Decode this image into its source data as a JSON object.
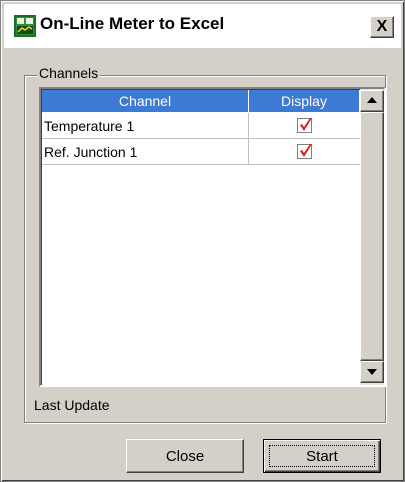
{
  "window": {
    "title": "On-Line Meter to Excel",
    "close_glyph": "X",
    "icon": "excel-meter-icon"
  },
  "channels_group": {
    "label": "Channels"
  },
  "table": {
    "columns": [
      "Channel",
      "Display"
    ],
    "rows": [
      {
        "channel": "Temperature 1",
        "display": true
      },
      {
        "channel": "Ref. Junction 1",
        "display": true
      }
    ],
    "header_color": "#3d7ad6",
    "check_color": "#e0201c"
  },
  "status": {
    "last_update_label": "Last Update"
  },
  "buttons": {
    "close_label": "Close",
    "start_label": "Start"
  }
}
